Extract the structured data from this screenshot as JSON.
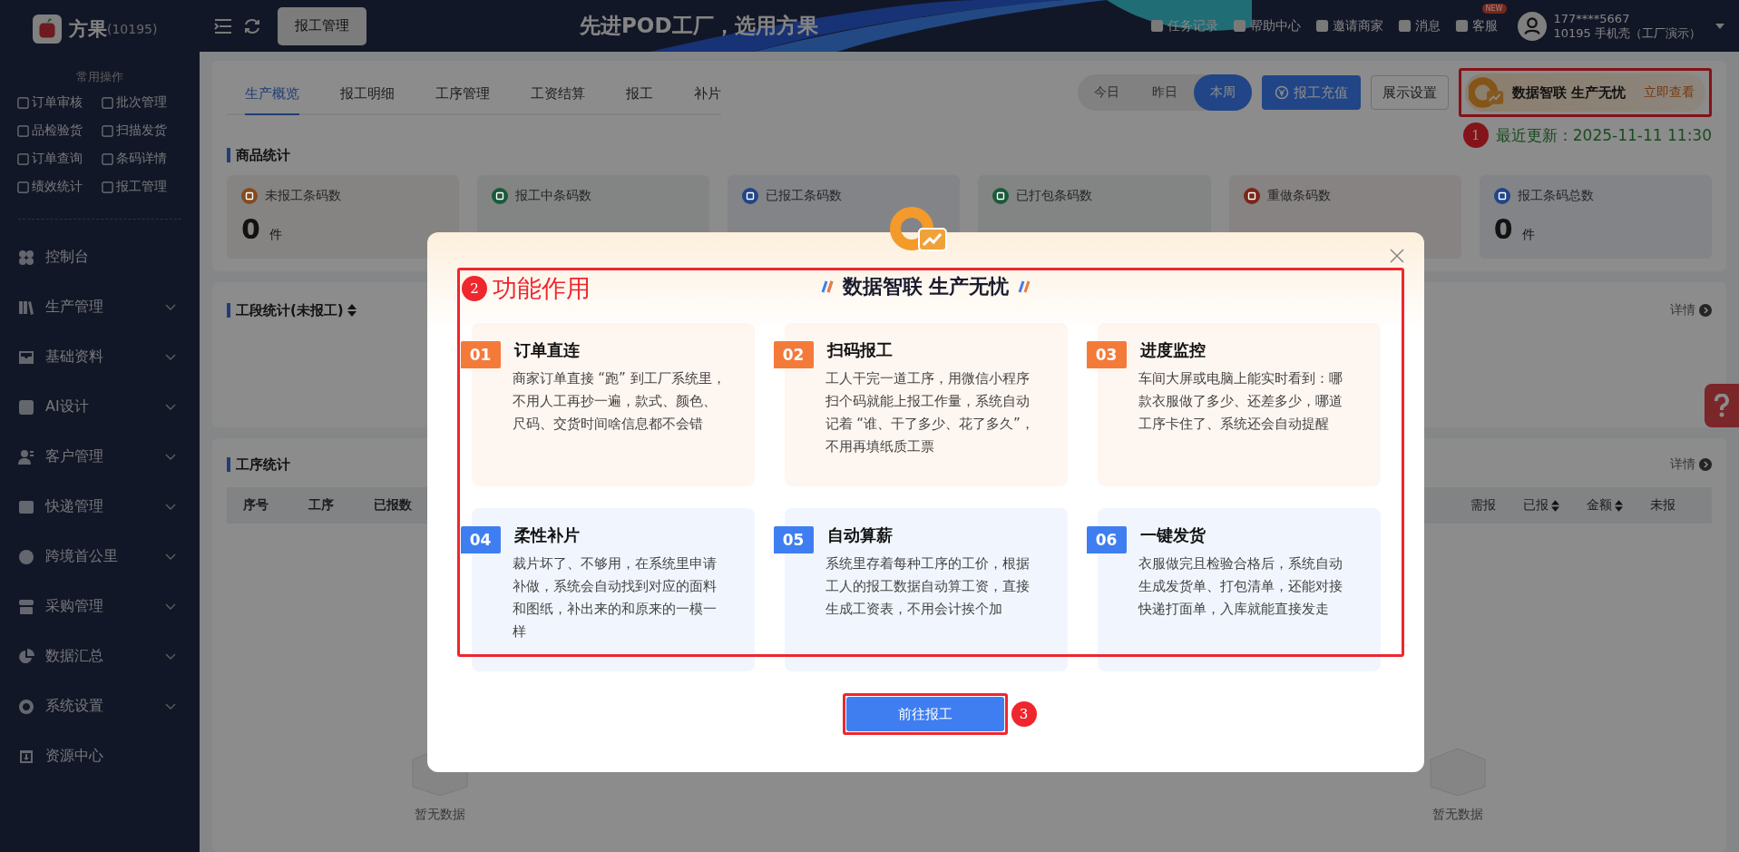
{
  "brand": {
    "name": "方果",
    "code": "(10195)"
  },
  "sidebar": {
    "quick_title": "常用操作",
    "quick_actions": [
      {
        "label": "订单审核"
      },
      {
        "label": "批次管理"
      },
      {
        "label": "品检验货"
      },
      {
        "label": "扫描发货"
      },
      {
        "label": "订单查询"
      },
      {
        "label": "条码详情"
      },
      {
        "label": "绩效统计"
      },
      {
        "label": "报工管理"
      }
    ],
    "menu": [
      {
        "label": "控制台",
        "expandable": false
      },
      {
        "label": "生产管理",
        "expandable": true
      },
      {
        "label": "基础资料",
        "expandable": true
      },
      {
        "label": "AI设计",
        "expandable": true
      },
      {
        "label": "客户管理",
        "expandable": true
      },
      {
        "label": "快递管理",
        "expandable": true
      },
      {
        "label": "跨境首公里",
        "expandable": true
      },
      {
        "label": "采购管理",
        "expandable": true
      },
      {
        "label": "数据汇总",
        "expandable": true
      },
      {
        "label": "系统设置",
        "expandable": true
      },
      {
        "label": "资源中心",
        "expandable": false
      }
    ]
  },
  "topbar": {
    "open_tab": "报工管理",
    "slogan": "先进POD工厂，选用方果",
    "links": [
      {
        "label": "任务记录"
      },
      {
        "label": "帮助中心"
      },
      {
        "label": "邀请商家"
      },
      {
        "label": "消息"
      },
      {
        "label": "客服",
        "badge": "NEW"
      }
    ],
    "user": {
      "phone": "177****5667",
      "org": "10195  手机壳（工厂演示）"
    }
  },
  "tabs": [
    {
      "label": "生产概览",
      "selected": true
    },
    {
      "label": "报工明细",
      "selected": false
    },
    {
      "label": "工序管理",
      "selected": false
    },
    {
      "label": "工资结算",
      "selected": false
    },
    {
      "label": "报工",
      "selected": false
    },
    {
      "label": "补片",
      "selected": false
    }
  ],
  "periods": [
    {
      "label": "今日",
      "selected": false
    },
    {
      "label": "昨日",
      "selected": false
    },
    {
      "label": "本周",
      "selected": true
    }
  ],
  "recharge_button": "报工充值",
  "settings_button": "展示设置",
  "promo": {
    "title": "数据智联 生产无忧",
    "link": "立即查看",
    "marker": "1"
  },
  "last_updated": "最近更新：2025-11-11 11:30",
  "goods_stats": {
    "title": "商品统计",
    "cards": [
      {
        "label": "未报工条码数",
        "value": "0",
        "unit": "件",
        "color": "#844b20"
      },
      {
        "label": "报工中条码数",
        "color": "#1a5a3b"
      },
      {
        "label": "已报工条码数",
        "color": "#224587"
      },
      {
        "label": "已打包条码数",
        "color": "#1a5a3b"
      },
      {
        "label": "重做条码数",
        "color": "#7b261a"
      },
      {
        "label": "报工条码总数",
        "value": "0",
        "unit": "件",
        "color": "#224587"
      }
    ]
  },
  "stage_stats": {
    "title": "工段统计(未报工)",
    "detail": "详情"
  },
  "process_stats": {
    "title": "工序统计",
    "detail": "详情",
    "left_columns": [
      {
        "label": "序号"
      },
      {
        "label": "工序"
      },
      {
        "label": "已报数"
      }
    ],
    "right_columns": [
      {
        "label": "需报",
        "sortable": false
      },
      {
        "label": "已报",
        "sortable": true
      },
      {
        "label": "金额",
        "sortable": true
      },
      {
        "label": "未报",
        "sortable": false
      }
    ],
    "empty_texts": [
      "暂无数据",
      "暂无数据"
    ]
  },
  "modal": {
    "heading": "数据智联 生产无忧",
    "section_label": "功能作用",
    "section_marker": "2",
    "features": [
      {
        "number": "01",
        "title": "订单直连",
        "text": "商家订单直接 “跑” 到工厂系统里，不用人工再抄一遍，款式、颜色、尺码、交货时间啥信息都不会错",
        "color": "#f47a3a"
      },
      {
        "number": "02",
        "title": "扫码报工",
        "text": "工人干完一道工序，用微信小程序扫个码就能上报工作量，系统自动记着 “谁、干了多少、花了多久”，不用再填纸质工票",
        "color": "#f47a3a"
      },
      {
        "number": "03",
        "title": "进度监控",
        "text": "车间大屏或电脑上能实时看到：哪款衣服做了多少、还差多少，哪道工序卡住了、系统还会自动提醒",
        "color": "#f47a3a"
      },
      {
        "number": "04",
        "title": "柔性补片",
        "text": "裁片坏了、不够用，在系统里申请补做，系统会自动找到对应的面料和图纸，补出来的和原来的一模一样",
        "color": "#3f7ef0"
      },
      {
        "number": "05",
        "title": "自动算薪",
        "text": "系统里存着每种工序的工价，根据工人的报工数据自动算工资，直接生成工资表，不用会计挨个加",
        "color": "#3f7ef0"
      },
      {
        "number": "06",
        "title": "一键发货",
        "text": "衣服做完且检验合格后，系统自动生成发货单、打包清单，还能对接快递打面单，入库就能直接发走",
        "color": "#3f7ef0"
      }
    ],
    "button": "前往报工",
    "button_marker": "3"
  }
}
